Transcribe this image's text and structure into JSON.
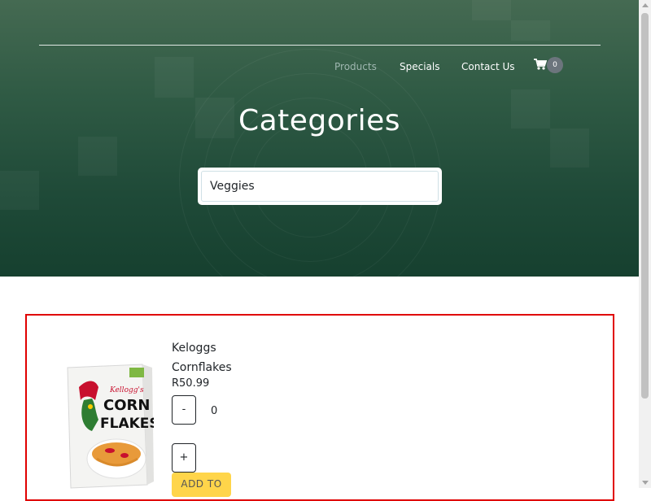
{
  "nav": {
    "items": [
      "Products",
      "Specials",
      "Contact Us"
    ],
    "active": "Products",
    "cart_count": "0"
  },
  "hero": {
    "title": "Categories",
    "search_value": "Veggies"
  },
  "product": {
    "name": "Keloggs Cornflakes",
    "price": "R50.99",
    "quantity": "0",
    "decrement_label": "-",
    "increment_label": "+",
    "add_label": "ADD TO",
    "image_text": {
      "brand": "Kellogg's",
      "line1": "CORN",
      "line2": "FLAKES"
    }
  },
  "colors": {
    "hero_top": "#456a52",
    "hero_bottom": "#16402f",
    "card_border": "#e00000",
    "add_button": "#ffd54a"
  },
  "icons": [
    "cart-icon"
  ]
}
